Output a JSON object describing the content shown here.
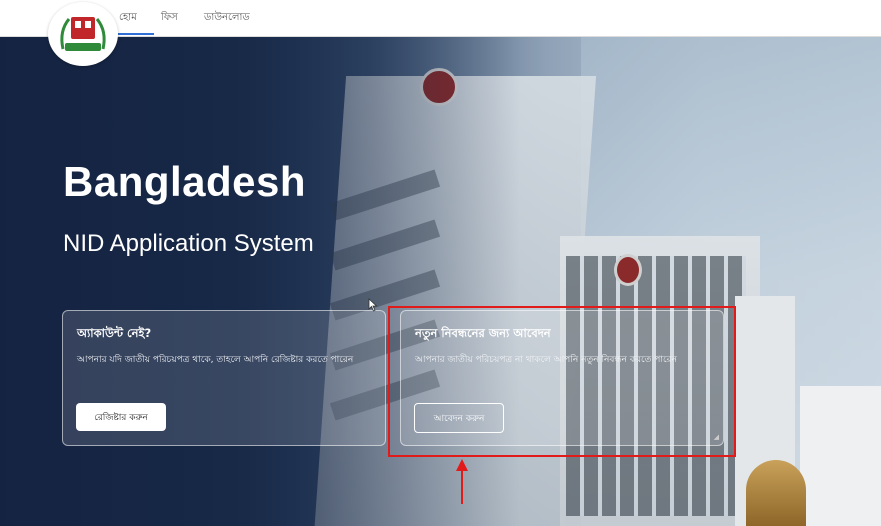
{
  "nav": {
    "items": [
      "হোম",
      "ফিস",
      "ডাউনলোড"
    ]
  },
  "hero": {
    "title": "Bangladesh",
    "subtitle": "NID Application System"
  },
  "cards": [
    {
      "title": "অ্যাকাউন্ট নেই?",
      "description": "আপনার যদি জাতীয় পরিচয়পত্র থাকে, তাহলে আপনি রেজিষ্টার করতে পারেন",
      "button": "রেজিষ্টার করুন"
    },
    {
      "title": "নতুন নিবন্ধনের জন্য আবেদন",
      "description": "আপনার জাতীয় পরিচয়পত্র না থাকলে আপনি নতুন নিবন্ধন করতে পারেন",
      "button": "আবেদন করুন"
    }
  ],
  "colors": {
    "highlight": "#e11a1a",
    "nav_accent": "#2f6fd6"
  }
}
